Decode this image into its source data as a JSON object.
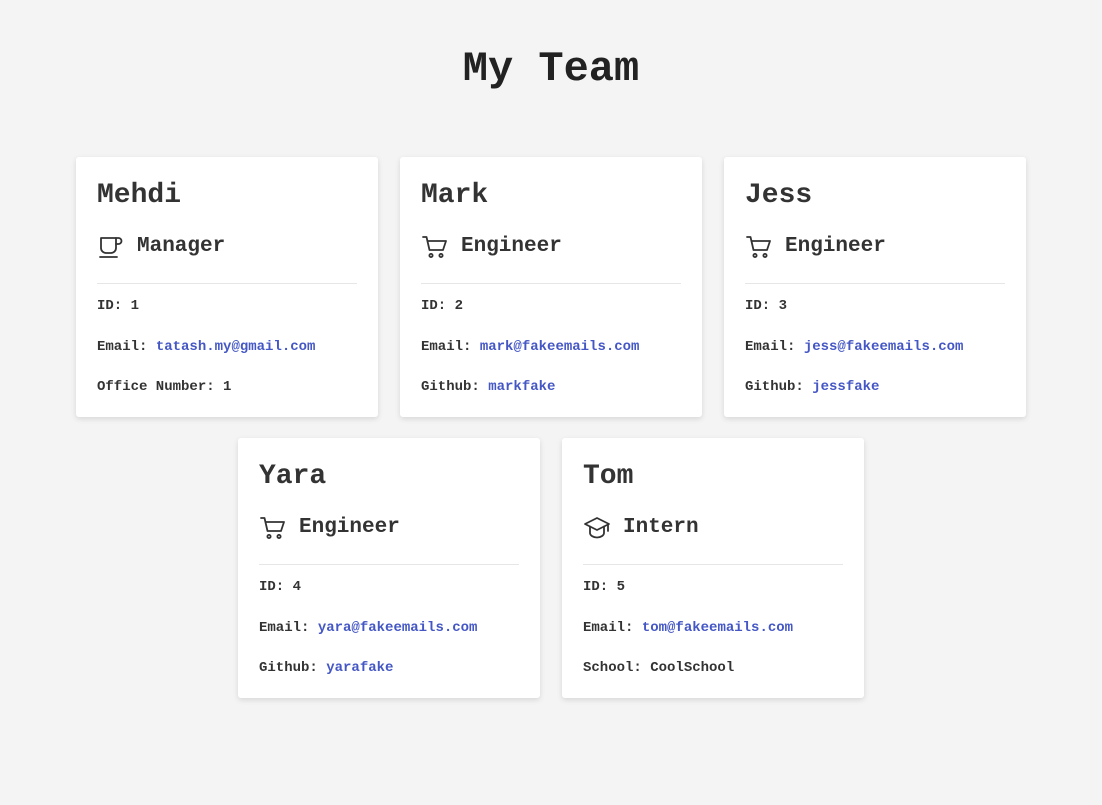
{
  "page": {
    "title": "My Team"
  },
  "colors": {
    "background": "#f4f4f4",
    "card": "#ffffff",
    "text": "#333333",
    "link": "#4457c5"
  },
  "labels": {
    "id": "ID:",
    "email": "Email:",
    "office": "Office Number:",
    "github": "Github:",
    "school": "School:"
  },
  "employees": [
    {
      "name": "Mehdi",
      "role": "Manager",
      "icon": "coffee-cup-icon",
      "id": "1",
      "email": "tatash.my@gmail.com",
      "office_number": "1"
    },
    {
      "name": "Mark",
      "role": "Engineer",
      "icon": "shopping-cart-icon",
      "id": "2",
      "email": "mark@fakeemails.com",
      "github": "markfake"
    },
    {
      "name": "Jess",
      "role": "Engineer",
      "icon": "shopping-cart-icon",
      "id": "3",
      "email": "jess@fakeemails.com",
      "github": "jessfake"
    },
    {
      "name": "Yara",
      "role": "Engineer",
      "icon": "shopping-cart-icon",
      "id": "4",
      "email": "yara@fakeemails.com",
      "github": "yarafake"
    },
    {
      "name": "Tom",
      "role": "Intern",
      "icon": "graduation-cap-icon",
      "id": "5",
      "email": "tom@fakeemails.com",
      "school": "CoolSchool"
    }
  ]
}
